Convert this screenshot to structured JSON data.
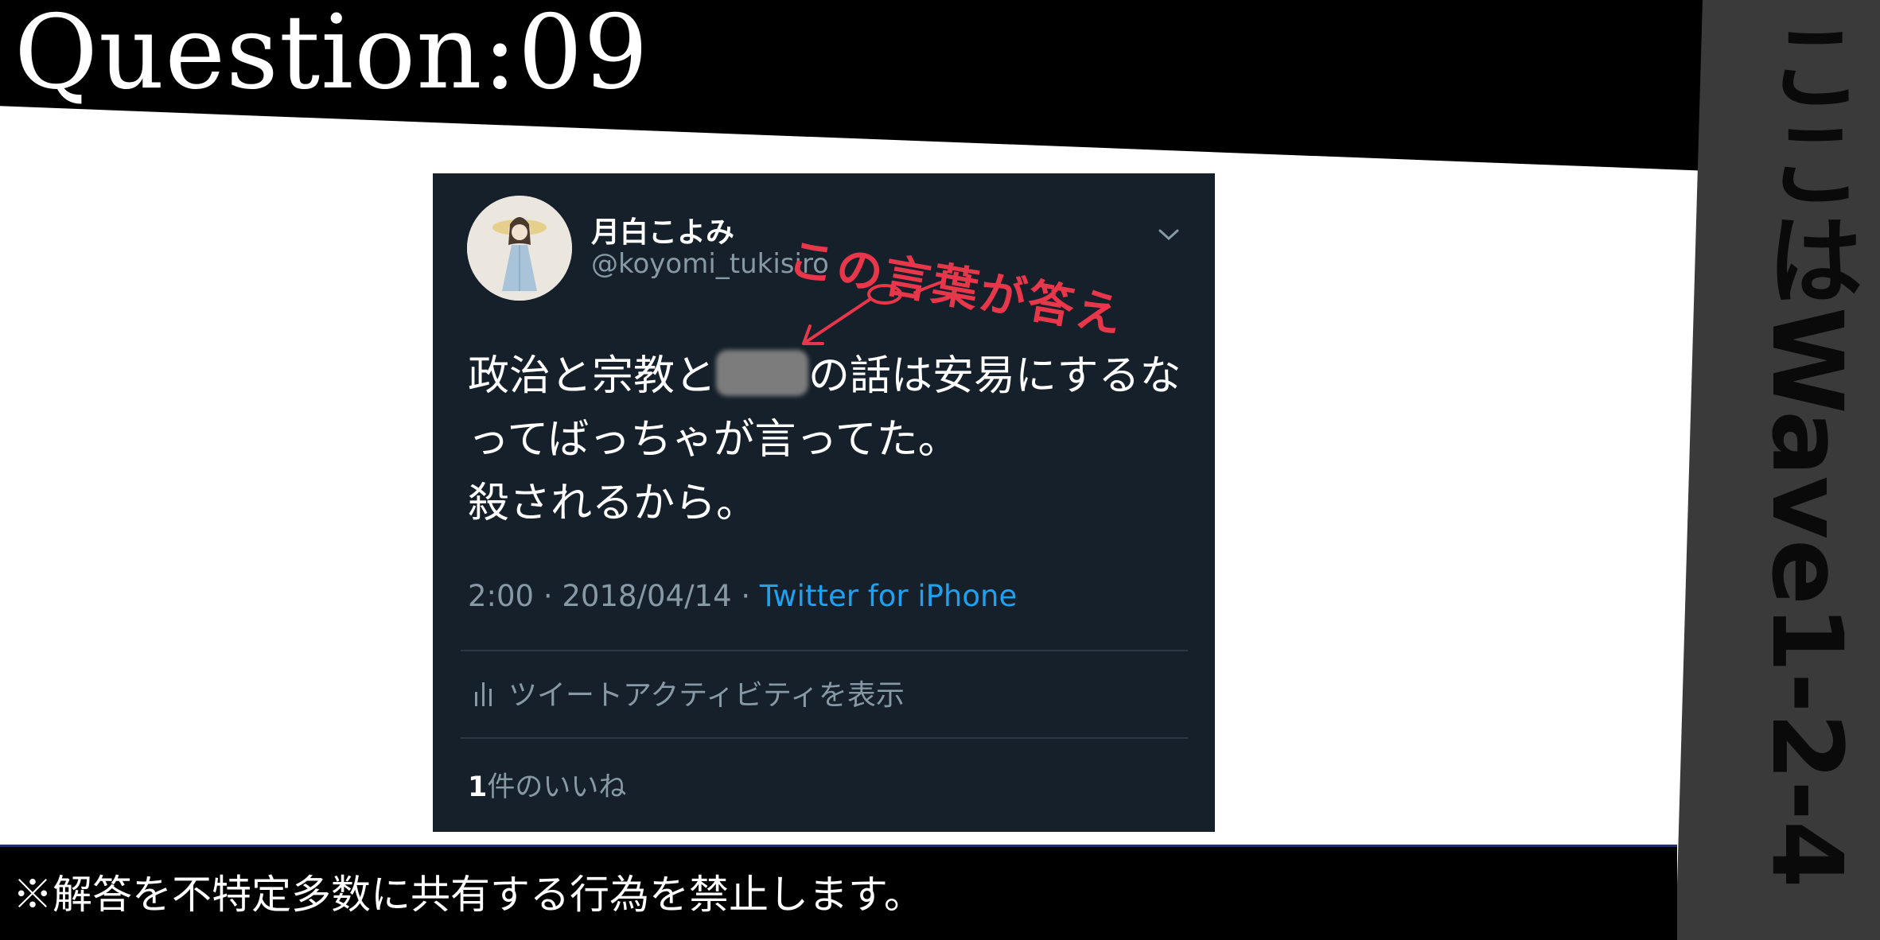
{
  "header": {
    "title": "Question:09"
  },
  "side_label": "ここはWave1-2-4",
  "tweet": {
    "display_name": "月白こよみ",
    "handle": "@koyomi_tukisiro",
    "body_before": "政治と宗教と",
    "body_after": "の話は安易にするなってばっちゃが言ってた。",
    "body_line3": "殺されるから。",
    "time_date": "2:00 · 2018/04/14 · ",
    "source": "Twitter for iPhone",
    "activity_label": "ツイートアクティビティを表示",
    "likes_count": "1",
    "likes_label": "件のいいね"
  },
  "annotation": "この言葉が答え",
  "notice": "※解答を不特定多数に共有する行為を禁止します。",
  "colors": {
    "annotation": "#e8364a",
    "tweet_bg": "#15202b",
    "link": "#1da1f2",
    "side_band": "#3a3a3a"
  }
}
